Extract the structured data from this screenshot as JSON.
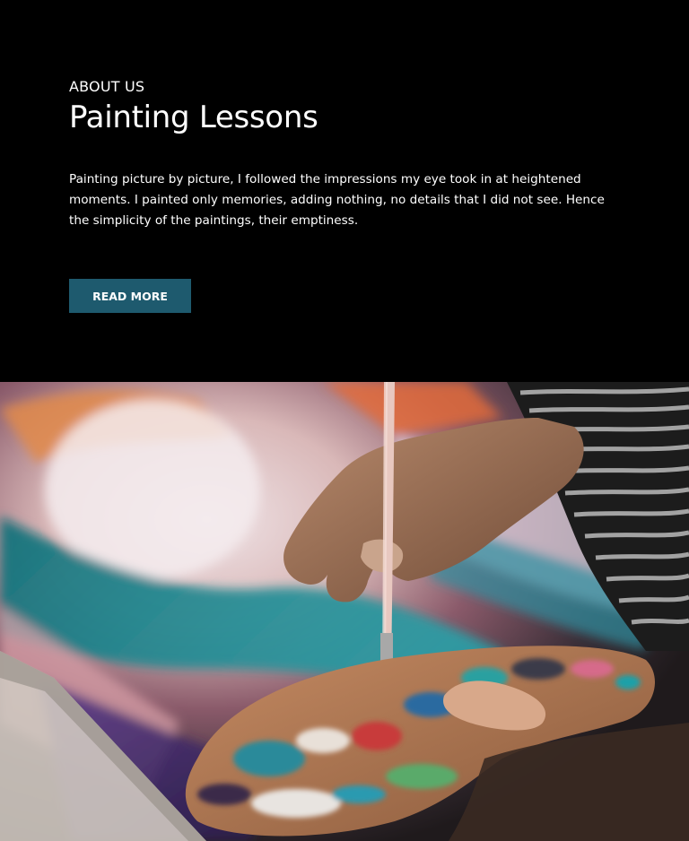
{
  "about": {
    "eyebrow": "ABOUT US",
    "title": "Painting Lessons",
    "body": "Painting picture by picture, I followed the impressions my eye took in at heightened moments. I painted only memories, adding nothing, no details that I did not see. Hence the simplicity of the paintings, their emptiness.",
    "button_label": "READ MORE"
  },
  "colors": {
    "background": "#000000",
    "accent": "#1e5a6e",
    "text": "#ffffff"
  },
  "image": {
    "subject": "painting-hand-brush-palette-photo"
  }
}
